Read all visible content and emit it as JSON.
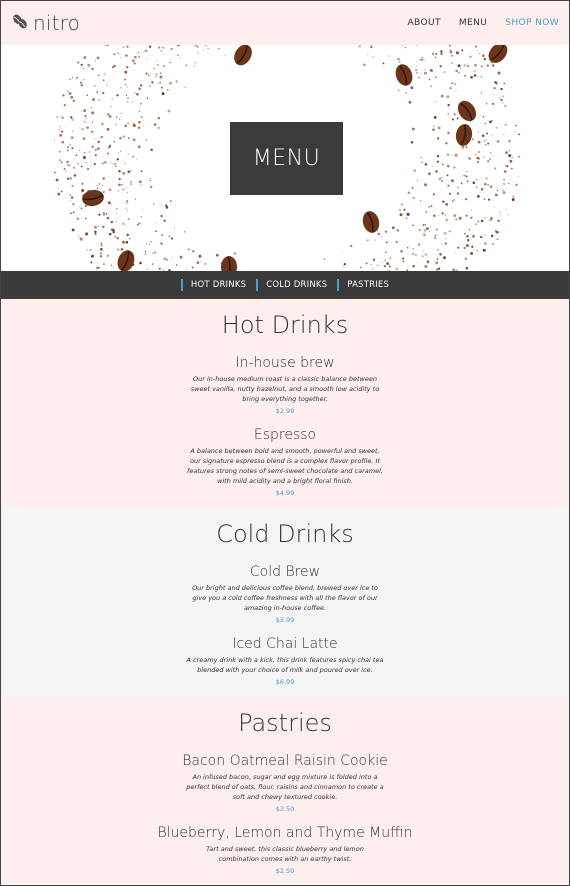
{
  "brand": {
    "name": "nitro",
    "logo_icon": "coffee-beans-icon"
  },
  "nav": {
    "about": "ABOUT",
    "menu": "MENU",
    "shop": "SHOP NOW"
  },
  "colors": {
    "accent": "#4a9fc9",
    "header_bg": "#fcefed",
    "subnav_bg": "#3a3a3a",
    "section_gray": "#f4f4f4"
  },
  "hero": {
    "title": "MENU"
  },
  "subnav": {
    "items": [
      "HOT DRINKS",
      "COLD DRINKS",
      "PASTRIES"
    ]
  },
  "sections": [
    {
      "title": "Hot Drinks",
      "items": [
        {
          "name": "In-house brew",
          "description": "Our in-house medium roast is a classic balance between sweet vanilla, nutty hazelnut, and a smooth low acidity to bring everything together.",
          "price": "$2.99"
        },
        {
          "name": "Espresso",
          "description": "A balance between bold and smooth, powerful and sweet, our signature espresso blend is a complex flavor profile. It features strong notes of semi-sweet chocolate and caramel, with mild acidity and a bright floral finish.",
          "price": "$4.99"
        }
      ]
    },
    {
      "title": "Cold Drinks",
      "items": [
        {
          "name": "Cold Brew",
          "description": "Our bright and delicious coffee blend, brewed over ice to give you a cold coffee freshness with all the flavor of our amazing in-house coffee.",
          "price": "$3.99"
        },
        {
          "name": "Iced Chai Latte",
          "description": "A creamy drink with a kick, this drink features spicy chai tea blended with your choice of milk and poured over ice.",
          "price": "$6.99"
        }
      ]
    },
    {
      "title": "Pastries",
      "items": [
        {
          "name": "Bacon Oatmeal Raisin Cookie",
          "description": "An infused bacon, sugar and egg mixture is folded into a perfect blend of oats, flour, raisins and cinnamon to create a soft and chewy textured cookie.",
          "price": "$3.50"
        },
        {
          "name": "Blueberry, Lemon and Thyme Muffin",
          "description": "Tart and sweet, this classic blueberry and lemon combination comes with an earthy twist.",
          "price": "$2.50"
        }
      ]
    }
  ]
}
